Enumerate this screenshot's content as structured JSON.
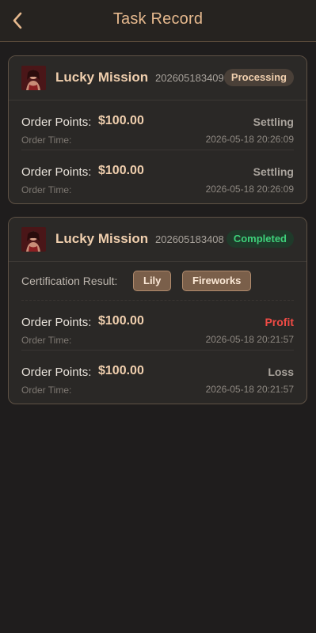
{
  "header": {
    "title": "Task Record",
    "back_icon": "chevron-left-icon"
  },
  "colors": {
    "accent": "#e6b98e",
    "profit": "#ef4b45",
    "completed": "#3ed07a"
  },
  "cards": [
    {
      "mission_name": "Lucky Mission",
      "order_no": "202605183409",
      "status": "Processing",
      "rows": [
        {
          "points_label": "Order Points:",
          "points_value": "$100.00",
          "status": "Settling",
          "time_label": "Order Time:",
          "time_value": "2026-05-18 20:26:09"
        },
        {
          "points_label": "Order Points:",
          "points_value": "$100.00",
          "status": "Settling",
          "time_label": "Order Time:",
          "time_value": "2026-05-18 20:26:09"
        }
      ]
    },
    {
      "mission_name": "Lucky Mission",
      "order_no": "202605183408",
      "status": "Completed",
      "certification": {
        "label": "Certification Result:",
        "tags": [
          "Lily",
          "Fireworks"
        ]
      },
      "rows": [
        {
          "points_label": "Order Points:",
          "points_value": "$100.00",
          "status": "Profit",
          "time_label": "Order Time:",
          "time_value": "2026-05-18 20:21:57"
        },
        {
          "points_label": "Order Points:",
          "points_value": "$100.00",
          "status": "Loss",
          "time_label": "Order Time:",
          "time_value": "2026-05-18 20:21:57"
        }
      ]
    }
  ]
}
